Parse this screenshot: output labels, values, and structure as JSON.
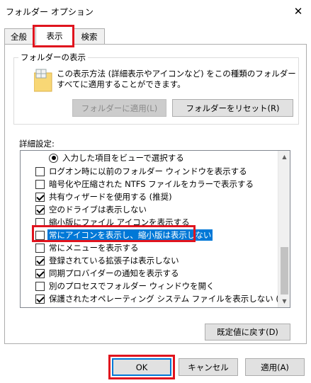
{
  "window": {
    "title": "フォルダー オプション",
    "close_glyph": "✕"
  },
  "tabs": [
    {
      "label": "全般",
      "active": false
    },
    {
      "label": "表示",
      "active": true
    },
    {
      "label": "検索",
      "active": false
    }
  ],
  "folder_view": {
    "group_title": "フォルダーの表示",
    "description": "この表示方法 (詳細表示やアイコンなど) をこの種類のフォルダーすべてに適用することができます。",
    "apply_to_folders_label": "フォルダーに適用(L)",
    "apply_to_folders_enabled": false,
    "reset_folders_label": "フォルダーをリセット(R)"
  },
  "advanced": {
    "label": "詳細設定:",
    "items": [
      {
        "type": "radio",
        "checked": true,
        "label": "入力した項目をビューで選択する",
        "selected": false
      },
      {
        "type": "checkbox",
        "checked": false,
        "label": "ログオン時に以前のフォルダー ウィンドウを表示する",
        "selected": false
      },
      {
        "type": "checkbox",
        "checked": false,
        "label": "暗号化や圧縮された NTFS ファイルをカラーで表示する",
        "selected": false
      },
      {
        "type": "checkbox",
        "checked": true,
        "label": "共有ウィザードを使用する (推奨)",
        "selected": false
      },
      {
        "type": "checkbox",
        "checked": true,
        "label": "空のドライブは表示しない",
        "selected": false
      },
      {
        "type": "checkbox",
        "checked": false,
        "label": "縮小版にファイル アイコンを表示する",
        "selected": false
      },
      {
        "type": "checkbox",
        "checked": false,
        "label": "常にアイコンを表示し、縮小版は表示しない",
        "selected": true
      },
      {
        "type": "checkbox",
        "checked": false,
        "label": "常にメニューを表示する",
        "selected": false
      },
      {
        "type": "checkbox",
        "checked": true,
        "label": "登録されている拡張子は表示しない",
        "selected": false
      },
      {
        "type": "checkbox",
        "checked": true,
        "label": "同期プロバイダーの通知を表示する",
        "selected": false
      },
      {
        "type": "checkbox",
        "checked": false,
        "label": "別のプロセスでフォルダー ウィンドウを開く",
        "selected": false
      },
      {
        "type": "checkbox",
        "checked": true,
        "label": "保護されたオペレーティング システム ファイルを表示しない (推奨)",
        "selected": false
      }
    ],
    "restore_defaults_label": "既定値に戻す(D)"
  },
  "footer": {
    "ok_label": "OK",
    "cancel_label": "キャンセル",
    "apply_label": "適用(A)"
  },
  "highlight_color": "#e0141e",
  "selection_color": "#0078d7"
}
